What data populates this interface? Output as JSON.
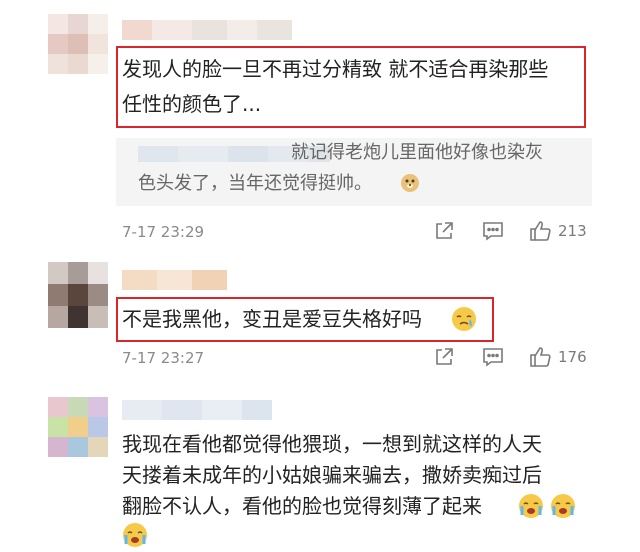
{
  "comments": [
    {
      "text_lines": [
        "发现人的脸一旦不再过分精致 就不适合再染那些",
        "任性的颜色了..."
      ],
      "quote_lines": [
        "就记得老炮儿里面他好像也染灰",
        "色头发了，当年还觉得挺帅。"
      ],
      "time": "7-17 23:29",
      "likes": "213",
      "quote_emoji": "doge-emoji"
    },
    {
      "text_lines": [
        "不是我黑他，变丑是爱豆失格好吗"
      ],
      "time": "7-17 23:27",
      "likes": "176",
      "emoji": "crying-emoji"
    },
    {
      "text_lines": [
        "我现在看他都觉得他猥琐，一想到就这样的人天",
        "天搂着未成年的小姑娘骗来骗去，撒娇卖痴过后",
        "翻脸不认人，看他的脸也觉得刻薄了起来"
      ],
      "emoji": "crying-emoji"
    }
  ],
  "colors": {
    "highlight": "#d8262b",
    "quote_bg": "#f4f4f4",
    "meta": "#8a8a8a"
  },
  "icons": [
    "share-icon",
    "comment-icon",
    "like-icon"
  ]
}
